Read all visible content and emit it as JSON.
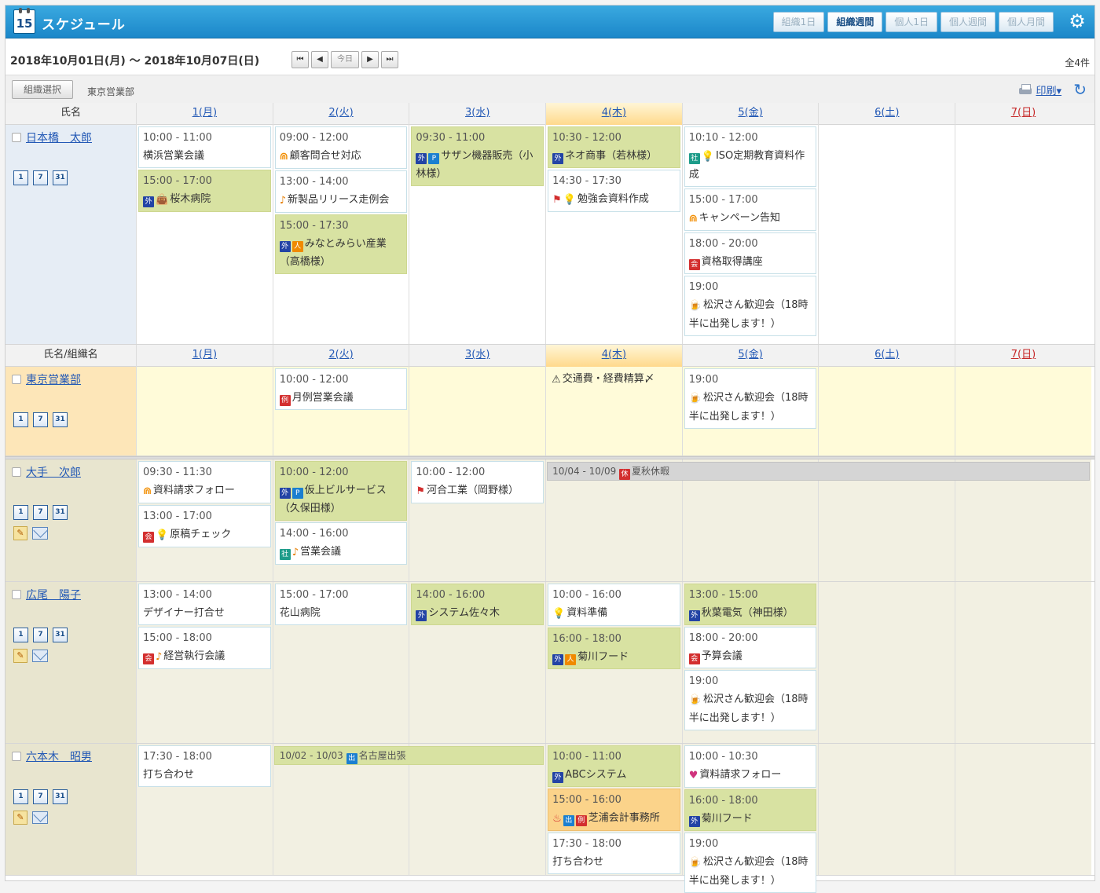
{
  "header": {
    "calendar_day": "15",
    "title": "スケジュール",
    "view_tabs": [
      "組織1日",
      "組織週間",
      "個人1日",
      "個人週間",
      "個人月間"
    ],
    "active_tab_index": 1
  },
  "nav": {
    "date_range": "2018年10月01日(月) ～ 2018年10月07日(日)",
    "first_label": "⏮",
    "prev_label": "◀",
    "today_label": "今日",
    "next_label": "▶",
    "last_label": "⏭",
    "total": "全4件"
  },
  "toolbar": {
    "org_select_label": "組織選択",
    "org_name": "東京営業部",
    "print_label": "印刷▾"
  },
  "columns": {
    "name_header": "氏名",
    "group_header": "氏名/組織名",
    "days": [
      "1(月)",
      "2(火)",
      "3(水)",
      "4(木)",
      "5(金)",
      "6(土)",
      "7(日)"
    ]
  },
  "mini_views": [
    "1",
    "7",
    "31"
  ],
  "rows": [
    {
      "name": "日本橋　太郎",
      "days": [
        [
          {
            "time": "10:00 - 11:00",
            "title": "横浜営業会議",
            "style": "white"
          },
          {
            "time": "15:00 - 17:00",
            "title": "桜木病院",
            "style": "green",
            "badges": [
              "外"
            ],
            "icon": "bag"
          }
        ],
        [
          {
            "time": "09:00 - 12:00",
            "title": "顧客問合せ対応",
            "style": "white",
            "icon": "rss"
          },
          {
            "time": "13:00 - 14:00",
            "title": "新製品リリース走例会",
            "style": "white",
            "icon": "note"
          },
          {
            "time": "15:00 - 17:30",
            "title": "みなとみらい産業（高橋様）",
            "style": "green",
            "badges": [
              "外",
              "人"
            ]
          }
        ],
        [
          {
            "time": "09:30 - 11:00",
            "title": "サザン機器販売（小林様）",
            "style": "green",
            "badges": [
              "外",
              "P"
            ]
          }
        ],
        [
          {
            "time": "10:30 - 12:00",
            "title": "ネオ商事（若林様）",
            "style": "green",
            "badges": [
              "外"
            ]
          },
          {
            "time": "14:30 - 17:30",
            "title": "勉強会資料作成",
            "style": "white",
            "icon": "flag",
            "icon2": "bulb"
          }
        ],
        [
          {
            "time": "10:10 - 12:00",
            "title": "ISO定期教育資料作成",
            "style": "white",
            "badges": [
              "社"
            ],
            "icon": "bulb"
          },
          {
            "time": "15:00 - 17:00",
            "title": "キャンペーン告知",
            "style": "white",
            "icon": "rss"
          },
          {
            "time": "18:00 - 20:00",
            "title": "資格取得講座",
            "style": "white",
            "badges": [
              "会"
            ]
          },
          {
            "time": "19:00",
            "title": "松沢さん歓迎会（18時半に出発します！）",
            "style": "white",
            "icon": "beer"
          }
        ],
        [],
        []
      ]
    },
    {
      "name": "東京営業部",
      "days": [
        [],
        [
          {
            "time": "10:00 - 12:00",
            "title": "月例営業会議",
            "style": "white",
            "badges": [
              "例"
            ]
          }
        ],
        [],
        [
          {
            "time": "",
            "title": "交通費・経費精算〆",
            "style": "plain",
            "icon": "warn"
          }
        ],
        [
          {
            "time": "19:00",
            "title": "松沢さん歓迎会（18時半に出発します！）",
            "style": "white",
            "icon": "beer"
          }
        ],
        [],
        []
      ]
    },
    {
      "name": "大手　次郎",
      "span": {
        "text": "10/04 - 10/09",
        "title": "夏秋休暇",
        "badge": "休"
      },
      "days": [
        [
          {
            "time": "09:30 - 11:30",
            "title": "資料請求フォロー",
            "style": "white",
            "icon": "rss"
          },
          {
            "time": "13:00 - 17:00",
            "title": "原稿チェック",
            "style": "white",
            "badges": [
              "会"
            ],
            "icon": "bulb"
          }
        ],
        [
          {
            "time": "10:00 - 12:00",
            "title": "仮上ビルサービス（久保田様）",
            "style": "green",
            "badges": [
              "外",
              "P"
            ]
          },
          {
            "time": "14:00 - 16:00",
            "title": "営業会議",
            "style": "white",
            "badges": [
              "社"
            ],
            "icon": "note"
          }
        ],
        [
          {
            "time": "10:00 - 12:00",
            "title": "河合工業（岡野様）",
            "style": "white",
            "icon": "flag"
          }
        ],
        [],
        [],
        [],
        []
      ]
    },
    {
      "name": "広尾　陽子",
      "days": [
        [
          {
            "time": "13:00 - 14:00",
            "title": "デザイナー打合せ",
            "style": "white"
          },
          {
            "time": "15:00 - 18:00",
            "title": "経営執行会議",
            "style": "white",
            "badges": [
              "会"
            ],
            "icon": "note"
          }
        ],
        [
          {
            "time": "15:00 - 17:00",
            "title": "花山病院",
            "style": "white"
          }
        ],
        [
          {
            "time": "14:00 - 16:00",
            "title": "システム佐々木",
            "style": "green",
            "badges": [
              "外"
            ]
          }
        ],
        [
          {
            "time": "10:00 - 16:00",
            "title": "資料準備",
            "style": "white",
            "icon": "bulb"
          },
          {
            "time": "16:00 - 18:00",
            "title": "菊川フード",
            "style": "green",
            "badges": [
              "外",
              "人"
            ]
          }
        ],
        [
          {
            "time": "13:00 - 15:00",
            "title": "秋葉電気（神田様）",
            "style": "green",
            "badges": [
              "外"
            ]
          },
          {
            "time": "18:00 - 20:00",
            "title": "予算会議",
            "style": "white",
            "badges": [
              "会"
            ]
          },
          {
            "time": "19:00",
            "title": "松沢さん歓迎会（18時半に出発します！）",
            "style": "white",
            "icon": "beer"
          }
        ],
        [],
        []
      ]
    },
    {
      "name": "六本木　昭男",
      "span": {
        "text": "10/02 - 10/03",
        "title": "名古屋出張",
        "badge": "出"
      },
      "days": [
        [
          {
            "time": "17:30 - 18:00",
            "title": "打ち合わせ",
            "style": "white"
          }
        ],
        [],
        [],
        [
          {
            "time": "10:00 - 11:00",
            "title": "ABCシステム",
            "style": "green",
            "badges": [
              "外"
            ]
          },
          {
            "time": "15:00 - 16:00",
            "title": "芝浦会計事務所",
            "style": "orange",
            "icon": "alert",
            "badges": [
              "出",
              "例"
            ]
          },
          {
            "time": "17:30 - 18:00",
            "title": "打ち合わせ",
            "style": "white"
          }
        ],
        [
          {
            "time": "10:00 - 10:30",
            "title": "資料請求フォロー",
            "style": "white",
            "icon": "heart"
          },
          {
            "time": "16:00 - 18:00",
            "title": "菊川フード",
            "style": "green",
            "badges": [
              "外"
            ]
          },
          {
            "time": "19:00",
            "title": "松沢さん歓迎会（18時半に出発します！）",
            "style": "white",
            "icon": "beer"
          }
        ],
        [],
        []
      ]
    }
  ],
  "colors": {
    "header_blue": "#1b87c9",
    "event_green": "#d8e2a2",
    "event_orange": "#fbd38a",
    "today_header": "#ffd98c",
    "sunday_red": "#c62828",
    "link_blue": "#2258b5"
  }
}
